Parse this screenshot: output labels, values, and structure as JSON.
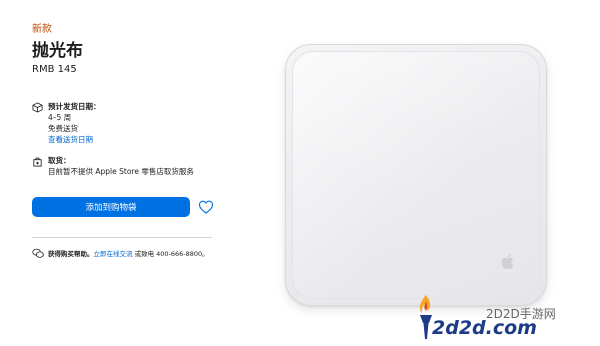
{
  "product": {
    "badge": "新款",
    "title": "抛光布",
    "price": "RMB 145"
  },
  "delivery": {
    "title": "预计发货日期：",
    "lines": [
      "4–5 周",
      "免费送货"
    ],
    "link": "查看送货日期"
  },
  "pickup": {
    "title": "取货：",
    "line": "目前暂不提供 Apple Store 零售店取货服务"
  },
  "actions": {
    "add_to_bag": "添加到购物袋"
  },
  "help": {
    "prefix": "获得购买帮助。",
    "link": "立即在线交流",
    "suffix": " 或致电 400-666-8800。"
  },
  "watermark": {
    "cn": "2D2D手游网",
    "en": "2d2d.com"
  },
  "colors": {
    "accent": "#0071e3",
    "link": "#0066cc",
    "badge": "#bf4800"
  },
  "icons": {
    "delivery": "box-icon",
    "pickup": "store-icon",
    "wishlist": "heart-icon",
    "help": "chat-bubbles-icon"
  }
}
